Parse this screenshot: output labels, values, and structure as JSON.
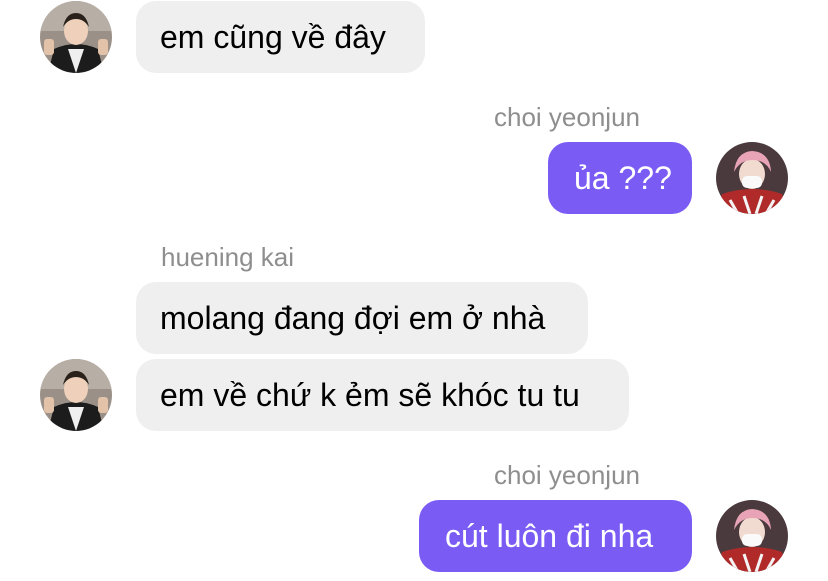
{
  "messages": [
    {
      "sender": "",
      "text": "em cũng về đây",
      "direction": "incoming"
    },
    {
      "sender": "choi yeonjun",
      "text": "ủa ???",
      "direction": "outgoing"
    },
    {
      "sender": "huening kai",
      "text": "molang đang đợi em ở nhà",
      "direction": "incoming"
    },
    {
      "sender": "",
      "text": "em về chứ k ẻm sẽ khóc tu tu",
      "direction": "incoming"
    },
    {
      "sender": "choi yeonjun",
      "text": "cút luôn đi nha",
      "direction": "outgoing"
    }
  ],
  "colors": {
    "incoming_bubble": "#efefef",
    "outgoing_bubble": "#7a5cf5",
    "sender_label": "#8e8e8e"
  },
  "avatars": {
    "incoming": "avatar-huening-kai",
    "outgoing": "avatar-choi-yeonjun"
  }
}
